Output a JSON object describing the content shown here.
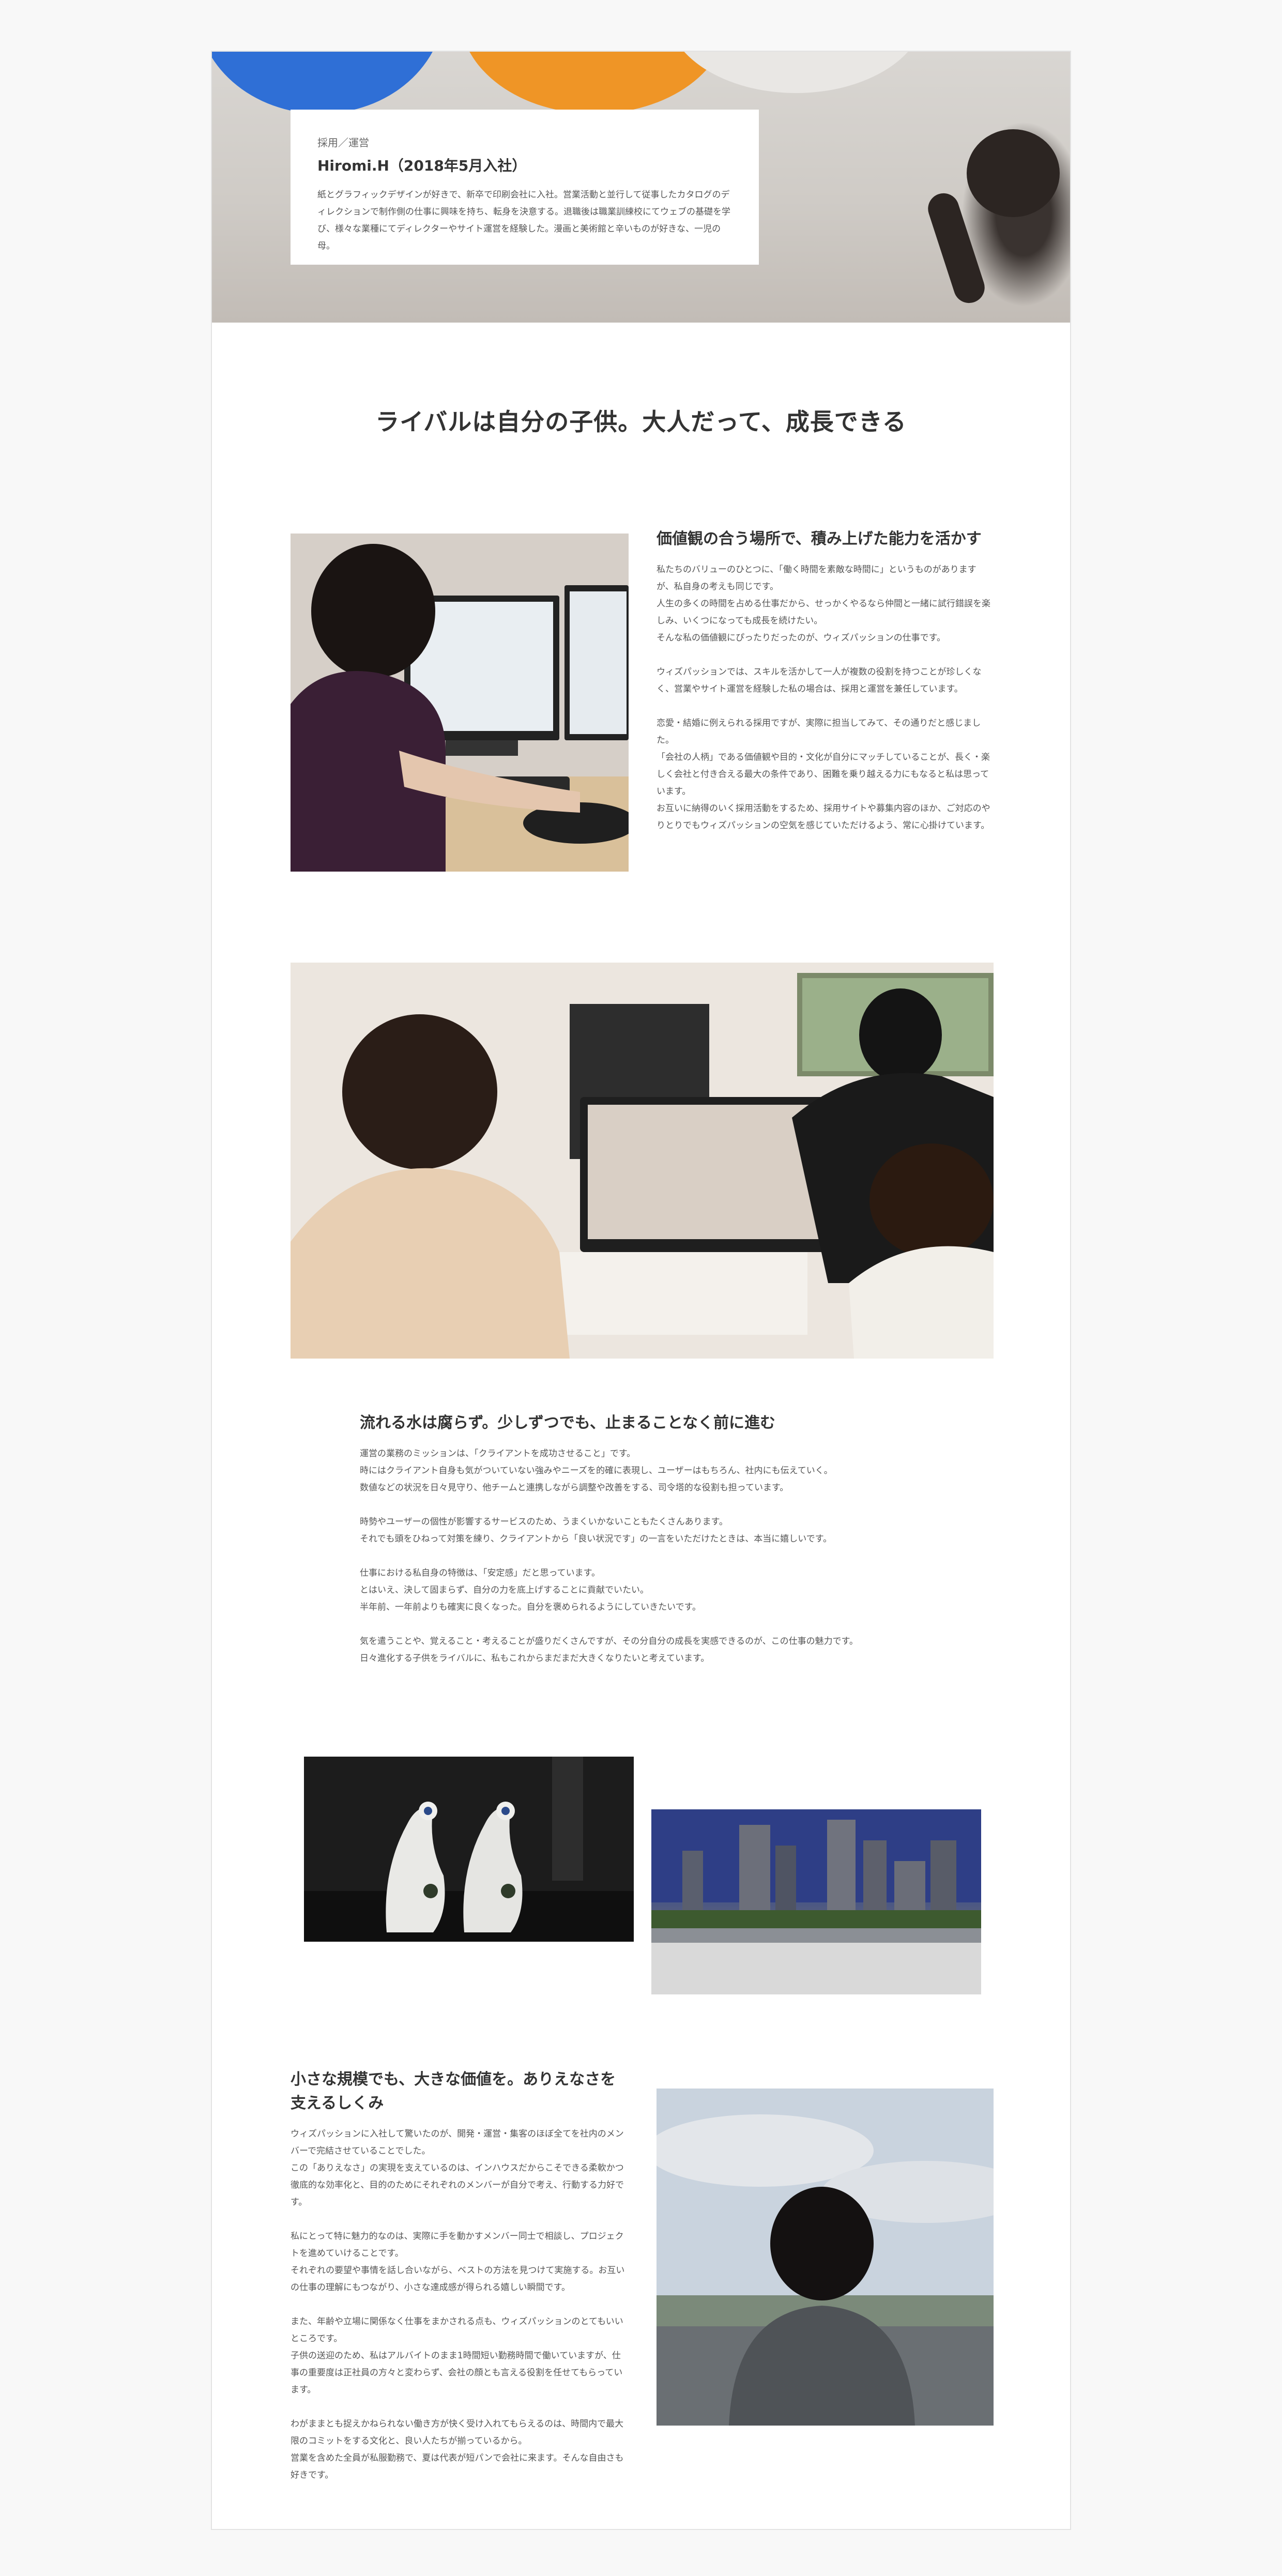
{
  "profile": {
    "role": "採用／運営",
    "name": "Hiromi.H（2018年5月入社）",
    "bio": "紙とグラフィックデザインが好きで、新卒で印刷会社に入社。営業活動と並行して従事したカタログのディレクションで制作側の仕事に興味を持ち、転身を決意する。退職後は職業訓練校にてウェブの基礎を学び、様々な業種にてディレクターやサイト運営を経験した。漫画と美術館と辛いものが好きな、一児の母。"
  },
  "main_title": "ライバルは自分の子供。大人だって、成長できる",
  "section1": {
    "heading": "価値観の合う場所で、積み上げた能力を活かす",
    "paragraphs": [
      "私たちのバリューのひとつに、「働く時間を素敵な時間に」というものがありますが、私自身の考えも同じです。\n人生の多くの時間を占める仕事だから、せっかくやるなら仲間と一緒に試行錯誤を楽しみ、いくつになっても成長を続けたい。\nそんな私の価値観にぴったりだったのが、ウィズパッションの仕事です。",
      "ウィズパッションでは、スキルを活かして一人が複数の役割を持つことが珍しくなく、営業やサイト運営を経験した私の場合は、採用と運営を兼任しています。",
      "恋愛・結婚に例えられる採用ですが、実際に担当してみて、その通りだと感じました。\n「会社の人柄」である価値観や目的・文化が自分にマッチしていることが、長く・楽しく会社と付き合える最大の条件であり、困難を乗り越える力にもなると私は思っています。\nお互いに納得のいく採用活動をするため、採用サイトや募集内容のほか、ご対応のやりとりでもウィズパッションの空気を感じていただけるよう、常に心掛けています。"
    ]
  },
  "section2": {
    "heading": "流れる水は腐らず。少しずつでも、止まることなく前に進む",
    "paragraphs": [
      "運営の業務のミッションは、「クライアントを成功させること」です。\n時にはクライアント自身も気がついていない強みやニーズを的確に表現し、ユーザーはもちろん、社内にも伝えていく。\n数値などの状況を日々見守り、他チームと連携しながら調整や改善をする、司令塔的な役割も担っています。",
      "時勢やユーザーの個性が影響するサービスのため、うまくいかないこともたくさんあります。\nそれでも頭をひねって対策を練り、クライアントから「良い状況です」の一言をいただけたときは、本当に嬉しいです。",
      "仕事における私自身の特徴は、「安定感」だと思っています。\nとはいえ、決して固まらず、自分の力を底上げすることに貢献でいたい。\n半年前、一年前よりも確実に良くなった。自分を褒められるようにしていきたいです。",
      "気を遣うことや、覚えること・考えることが盛りだくさんですが、その分自分の成長を実感できるのが、この仕事の魅力です。\n日々進化する子供をライバルに、私もこれからまだまだ大きくなりたいと考えています。"
    ]
  },
  "section3": {
    "heading": "小さな規模でも、大きな価値を。ありえなさを支えるしくみ",
    "paragraphs": [
      "ウィズパッションに入社して驚いたのが、開発・運営・集客のほぼ全てを社内のメンバーで完結させていることでした。\nこの「ありえなさ」の実現を支えているのは、インハウスだからこそできる柔軟かつ徹底的な効率化と、目的のためにそれぞれのメンバーが自分で考え、行動する力好です。",
      "私にとって特に魅力的なのは、実際に手を動かすメンバー同士で相談し、プロジェクトを進めていけることです。\nそれぞれの要望や事情を話し合いながら、ベストの方法を見つけて実施する。お互いの仕事の理解にもつながり、小さな達成感が得られる嬉しい瞬間です。",
      "また、年齢や立場に関係なく仕事をまかされる点も、ウィズパッションのとてもいいところです。\n子供の送迎のため、私はアルバイトのまま1時間短い勤務時間で働いていますが、仕事の重要度は正社員の方々と変わらず、会社の顔とも言える役割を任せてもらっています。",
      "わがままとも捉えかねられない働き方が快く受け入れてもらえるのは、時間内で最大限のコミットをする文化と、良い人たちが揃っているから。\n営業を含めた全員が私服勤務で、夏は代表が短パンで会社に来ます。そんな自由さも好きです。"
    ]
  },
  "images": {
    "hero": "hero-balloons-photo",
    "s1": "person-at-monitors-photo",
    "s2": "team-meeting-photo",
    "s3a": "ceramic-figures-photo",
    "s3b": "city-night-view-photo",
    "s4": "person-from-behind-photo"
  }
}
